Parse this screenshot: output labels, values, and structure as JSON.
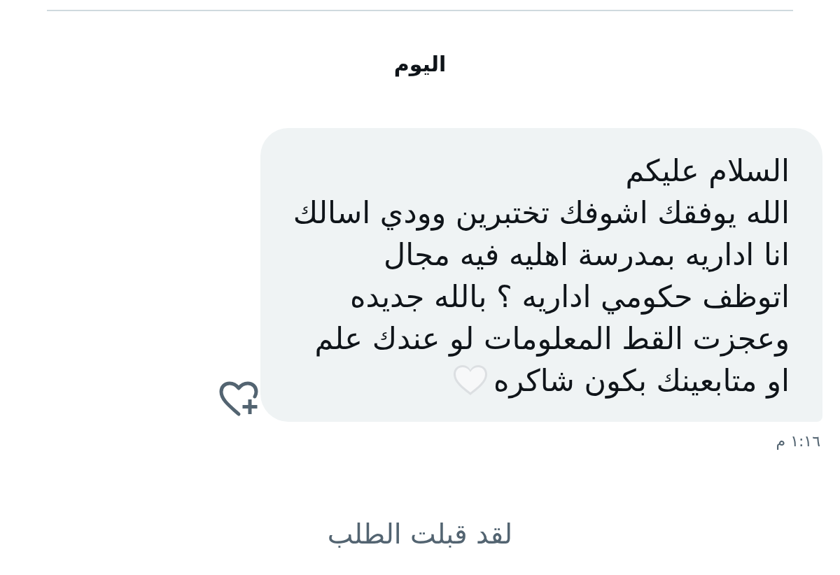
{
  "date_separator": "اليوم",
  "messages": [
    {
      "kind": "received",
      "lines": [
        "السلام عليكم",
        "الله يوفقك اشوفك تختبرين وودي اسالك",
        "انا اداريه بمدرسة اهليه فيه مجال",
        "اتوظف حكومي اداريه ؟ بالله جديده",
        "وعجزت القط المعلومات لو عندك علم",
        "او متابعينك بكون شاكره"
      ],
      "time": "١:١٦ م"
    }
  ],
  "system_notice": "لقد قبلت الطلب"
}
